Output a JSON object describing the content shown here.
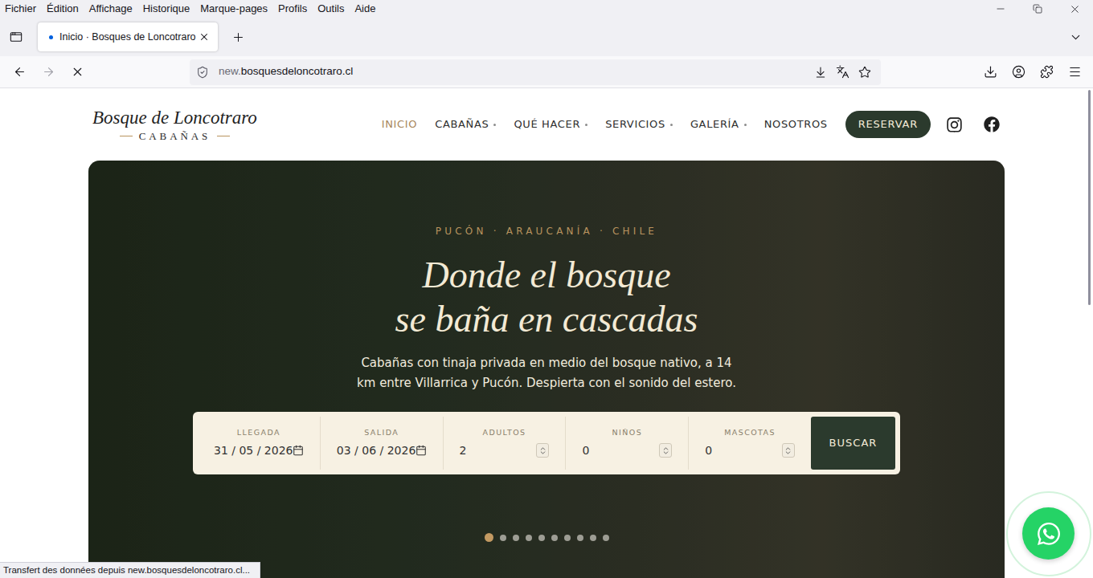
{
  "menu_bar": [
    "Fichier",
    "Édition",
    "Affichage",
    "Historique",
    "Marque-pages",
    "Profils",
    "Outils",
    "Aide"
  ],
  "tabs": [
    {
      "label": "Inicio · Bosques de Loncotraro",
      "selected": true,
      "loading": true
    }
  ],
  "toolbar": {
    "back_disabled": false,
    "forward_disabled": true,
    "loading": true,
    "url_prefix": "new.",
    "url_domain": "bosquesdeloncotraro.cl"
  },
  "site": {
    "logo": {
      "title": "Bosque de Loncotraro",
      "subtitle": "CABAÑAS"
    },
    "nav": [
      {
        "label": "INICIO",
        "selected": true,
        "has_dropdown": false
      },
      {
        "label": "CABAÑAS",
        "selected": false,
        "has_dropdown": true
      },
      {
        "label": "QUÉ HACER",
        "selected": false,
        "has_dropdown": true
      },
      {
        "label": "SERVICIOS",
        "selected": false,
        "has_dropdown": true
      },
      {
        "label": "GALERÍA",
        "selected": false,
        "has_dropdown": true
      },
      {
        "label": "NOSOTROS",
        "selected": false,
        "has_dropdown": false
      }
    ],
    "cta": "RESERVAR",
    "hero": {
      "eyebrow": "PUCÓN · ARAUCANÍA · CHILE",
      "heading": [
        "Donde el bosque",
        "se baña en cascadas"
      ],
      "text": "Cabañas con tinaja privada en medio del bosque nativo, a 14 km entre Villarrica y Pucón. Despierta con el sonido del estero."
    },
    "booking": {
      "fields": [
        {
          "label": "LLEGADA",
          "value": "31 / 05 / 2026",
          "kind": "date"
        },
        {
          "label": "SALIDA",
          "value": "03 / 06 / 2026",
          "kind": "date"
        },
        {
          "label": "ADULTOS",
          "value": "2",
          "kind": "number"
        },
        {
          "label": "NIÑOS",
          "value": "0",
          "kind": "number"
        },
        {
          "label": "MASCOTAS",
          "value": "0",
          "kind": "number"
        }
      ],
      "button": "BUSCAR"
    },
    "slides": [
      {
        "selected": true
      },
      {
        "selected": false
      },
      {
        "selected": false
      },
      {
        "selected": false
      },
      {
        "selected": false
      },
      {
        "selected": false
      },
      {
        "selected": false
      },
      {
        "selected": false
      },
      {
        "selected": false
      },
      {
        "selected": false
      }
    ]
  },
  "status_bar": "Transfert des données depuis new.bosquesdeloncotraro.cl..."
}
